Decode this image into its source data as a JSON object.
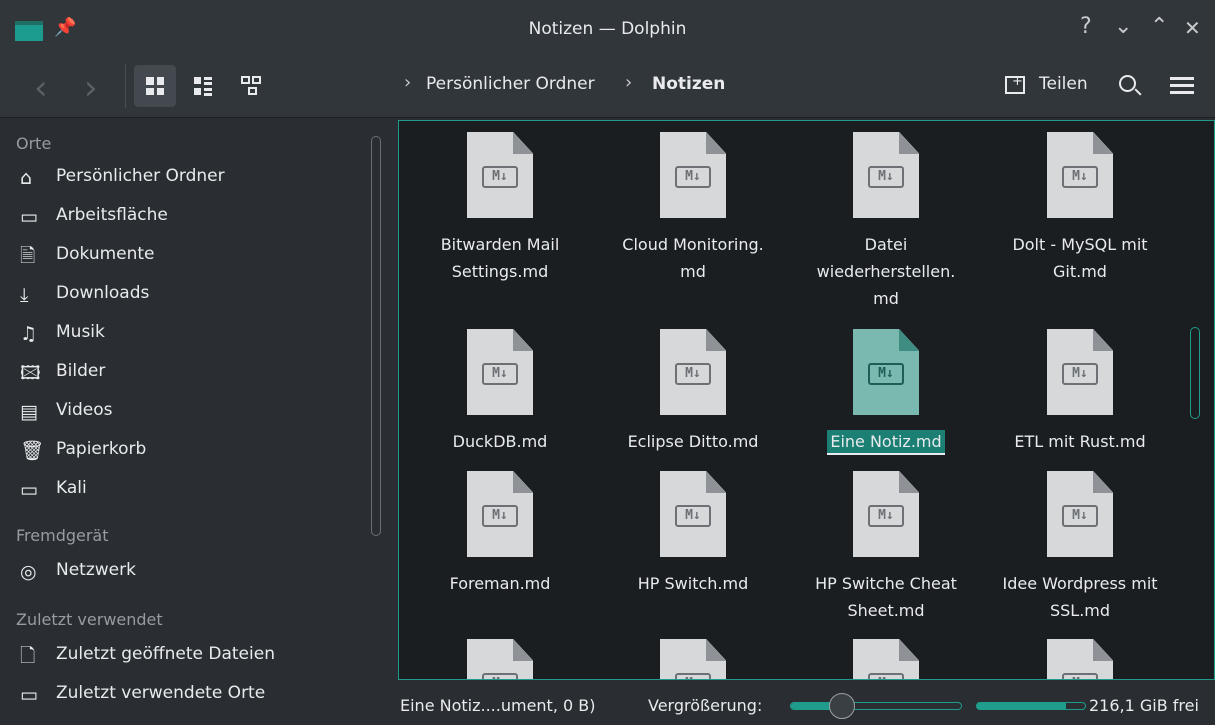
{
  "window": {
    "title": "Notizen — Dolphin"
  },
  "titlebar_buttons": [
    "?",
    "⌄",
    "⌃",
    "✕"
  ],
  "toolbar": {
    "breadcrumb": [
      "Persönlicher Ordner",
      "Notizen"
    ],
    "share_label": "Teilen"
  },
  "sidebar": {
    "sections": [
      {
        "title": "Orte",
        "items": [
          {
            "label": "Persönlicher Ordner",
            "icon": "home-icon"
          },
          {
            "label": "Arbeitsfläche",
            "icon": "desktop-icon"
          },
          {
            "label": "Dokumente",
            "icon": "documents-icon"
          },
          {
            "label": "Downloads",
            "icon": "downloads-icon"
          },
          {
            "label": "Musik",
            "icon": "music-icon"
          },
          {
            "label": "Bilder",
            "icon": "pictures-icon"
          },
          {
            "label": "Videos",
            "icon": "videos-icon"
          },
          {
            "label": "Papierkorb",
            "icon": "trash-icon"
          },
          {
            "label": "Kali",
            "icon": "folder-icon"
          }
        ]
      },
      {
        "title": "Fremdgerät",
        "items": [
          {
            "label": "Netzwerk",
            "icon": "network-icon"
          }
        ]
      },
      {
        "title": "Zuletzt verwendet",
        "items": [
          {
            "label": "Zuletzt geöffnete Dateien",
            "icon": "recent-files-icon"
          },
          {
            "label": "Zuletzt verwendete Orte",
            "icon": "recent-places-icon"
          }
        ]
      }
    ]
  },
  "files": [
    {
      "name": "Bitwarden Mail Settings.md",
      "lines": [
        "Bitwarden Mail",
        "Settings.md"
      ]
    },
    {
      "name": "Cloud Monitoring.md",
      "lines": [
        "Cloud Monitoring.",
        "md"
      ]
    },
    {
      "name": "Datei wiederherstellen.md",
      "lines": [
        "Datei",
        "wiederherstellen.",
        "md"
      ]
    },
    {
      "name": "Dolt - MySQL mit Git.md",
      "lines": [
        "Dolt - MySQL mit",
        "Git.md"
      ]
    },
    {
      "name": "DuckDB.md",
      "lines": [
        "DuckDB.md"
      ]
    },
    {
      "name": "Eclipse Ditto.md",
      "lines": [
        "Eclipse Ditto.md"
      ]
    },
    {
      "name": "Eine Notiz.md",
      "lines": [
        "Eine Notiz.md"
      ],
      "selected": true
    },
    {
      "name": "ETL mit Rust.md",
      "lines": [
        "ETL mit Rust.md"
      ]
    },
    {
      "name": "Foreman.md",
      "lines": [
        "Foreman.md"
      ]
    },
    {
      "name": "HP Switch.md",
      "lines": [
        "HP Switch.md"
      ]
    },
    {
      "name": "HP Switche Cheat Sheet.md",
      "lines": [
        "HP Switche Cheat",
        "Sheet.md"
      ]
    },
    {
      "name": "Idee Wordpress mit SSL.md",
      "lines": [
        "Idee Wordpress mit",
        "SSL.md"
      ]
    },
    {
      "name": "",
      "lines": []
    },
    {
      "name": "",
      "lines": []
    },
    {
      "name": "",
      "lines": []
    },
    {
      "name": "",
      "lines": []
    }
  ],
  "file_icon_label": "M↓",
  "status": {
    "selection": "Eine Notiz....ument, 0 B)",
    "zoom_label": "Vergrößerung:",
    "zoom_level": 0.3,
    "free_space": "216,1 GiB frei",
    "used_fraction": 0.82
  },
  "colors": {
    "accent": "#1f9c8c",
    "background": "#2a2e32",
    "view_background": "#1b1e20"
  }
}
